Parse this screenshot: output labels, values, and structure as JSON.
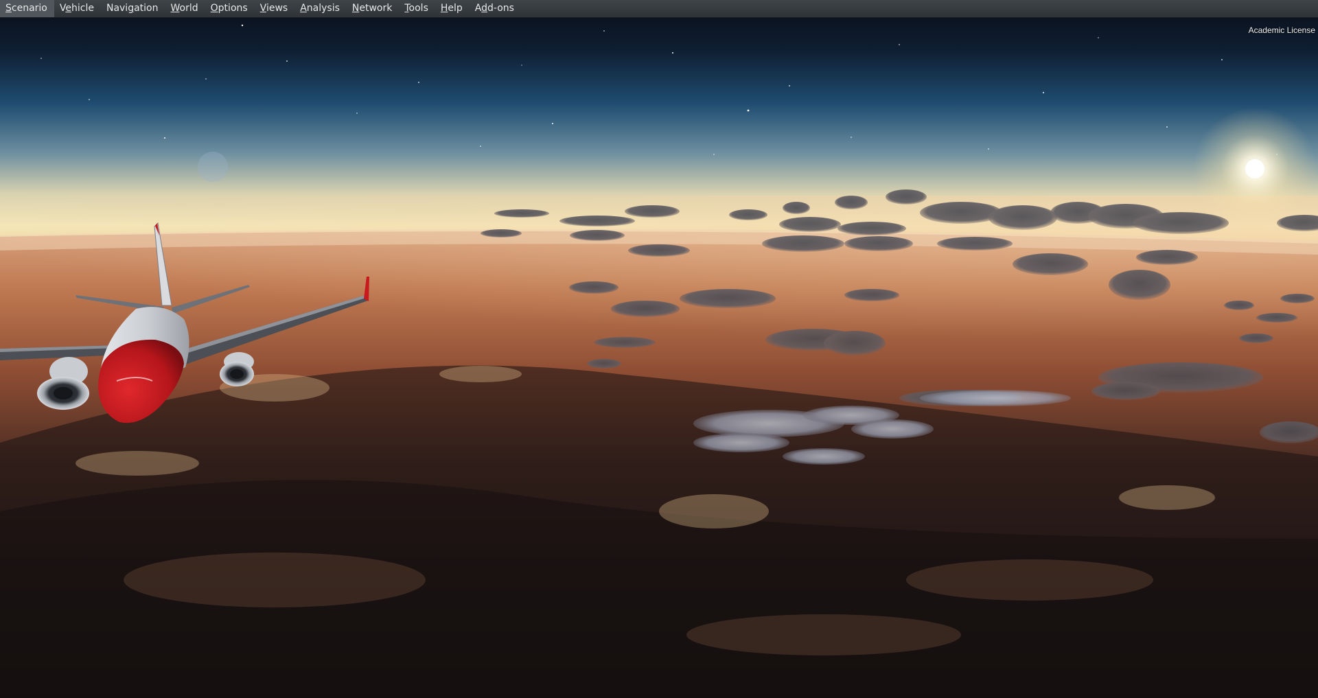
{
  "menubar": {
    "items": [
      {
        "pre": "",
        "key": "S",
        "post": "cenario"
      },
      {
        "pre": "V",
        "key": "e",
        "post": "hicle"
      },
      {
        "pre": "Navi",
        "key": "g",
        "post": "ation"
      },
      {
        "pre": "",
        "key": "W",
        "post": "orld"
      },
      {
        "pre": "",
        "key": "O",
        "post": "ptions"
      },
      {
        "pre": "",
        "key": "V",
        "post": "iews"
      },
      {
        "pre": "",
        "key": "A",
        "post": "nalysis"
      },
      {
        "pre": "",
        "key": "N",
        "post": "etwork"
      },
      {
        "pre": "",
        "key": "T",
        "post": "ools"
      },
      {
        "pre": "",
        "key": "H",
        "post": "elp"
      },
      {
        "pre": "A",
        "key": "d",
        "post": "d-ons"
      }
    ]
  },
  "overlay": {
    "license": "Academic License"
  },
  "scene": {
    "sky_top": "#0c1422",
    "sky_mid": "#1f4a6e",
    "sky_horizon": "#efe2b6",
    "ground_near": "#1e1514",
    "ground_far": "#b66a45",
    "aircraft_livery": "#c8191e"
  }
}
